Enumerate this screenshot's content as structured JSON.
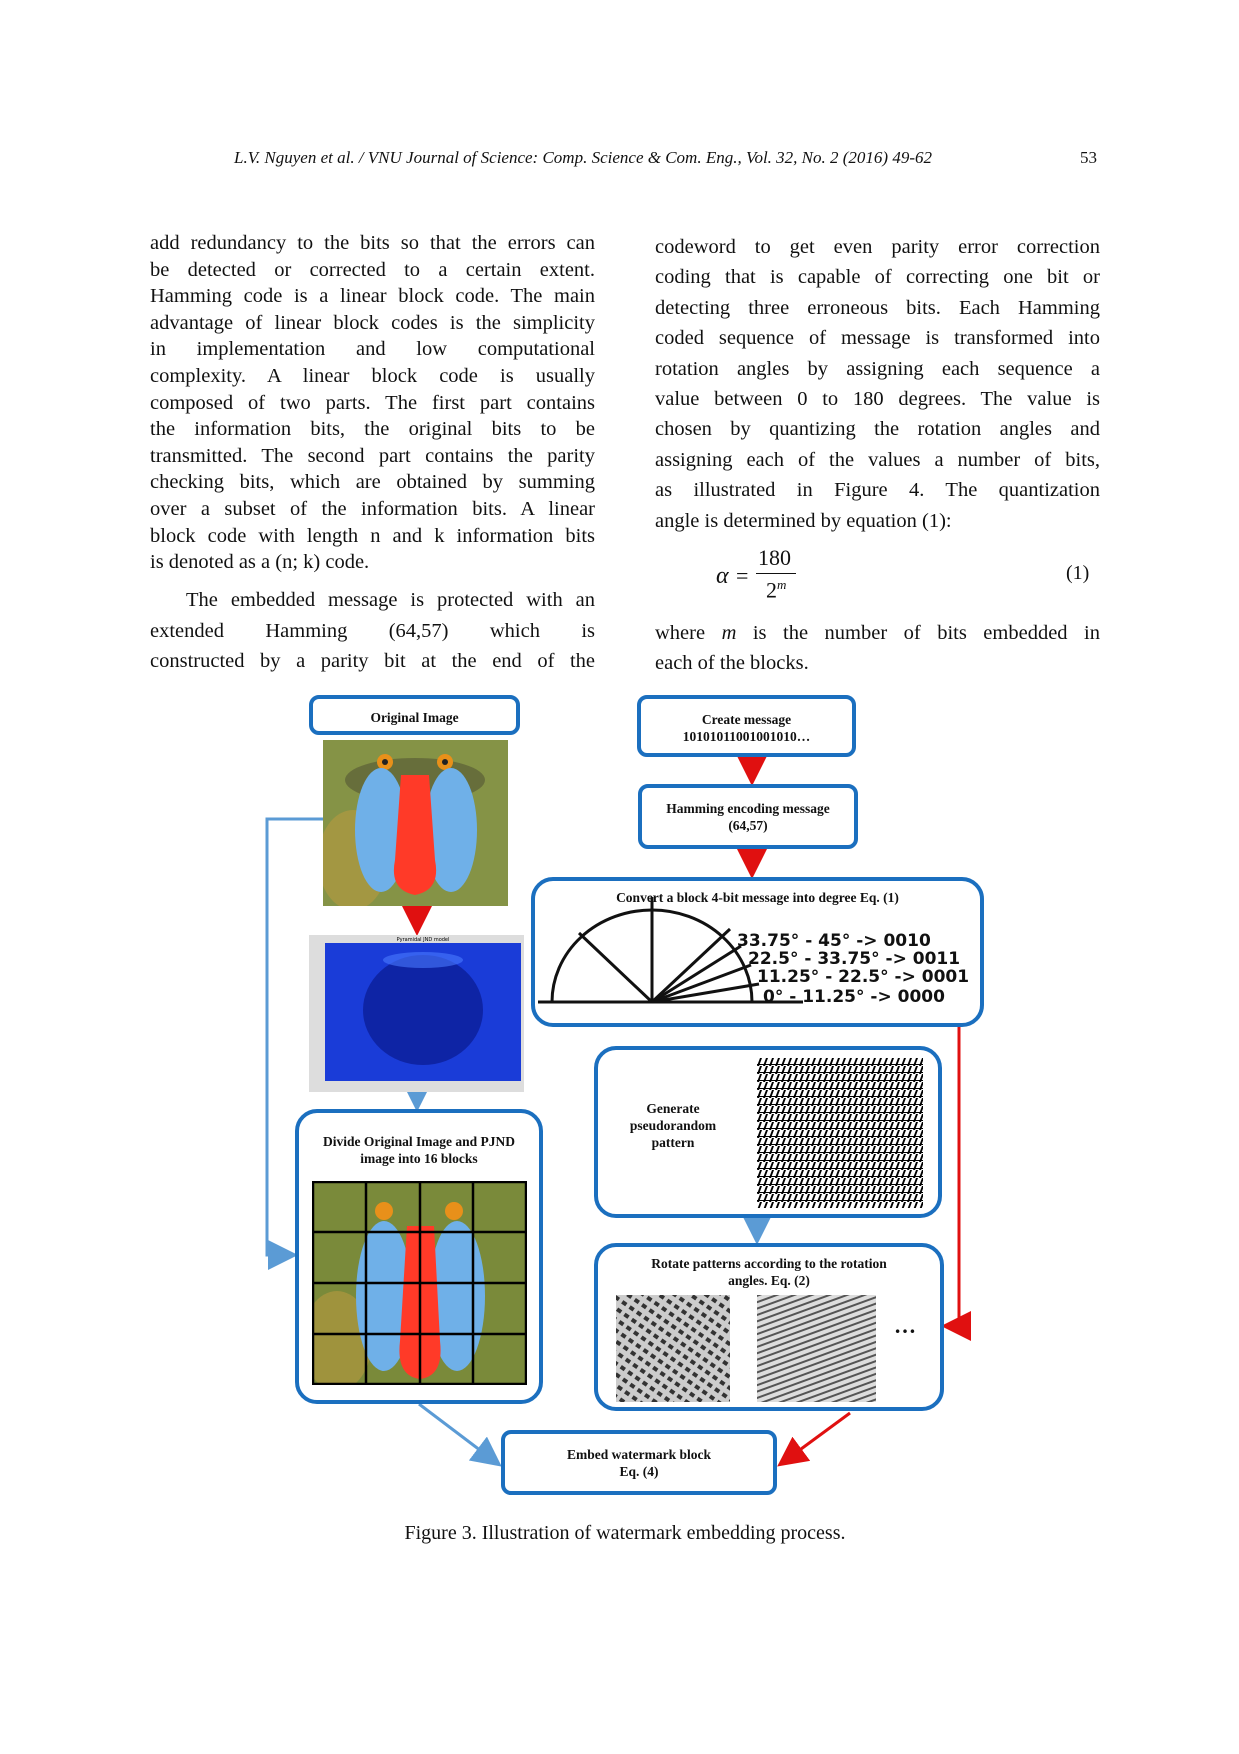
{
  "header": {
    "running_title": "L.V. Nguyen et al. / VNU Journal of Science: Comp. Science & Com. Eng., Vol. 32, No. 2 (2016) 49-62",
    "page_number": "53"
  },
  "left_column": {
    "paragraph1": [
      "add redundancy to the bits so that the errors can",
      "be detected or corrected to a certain extent.",
      "Hamming code is a linear block code. The main",
      "advantage of linear block codes is the simplicity",
      "in implementation and low computational",
      "complexity. A linear block code is usually",
      "composed of two parts. The first part contains",
      "the information bits, the original bits to be",
      "transmitted. The second part contains the parity",
      "checking bits, which are obtained by summing",
      "over a subset of the information bits. A linear",
      "block code with length n and k information bits",
      "is denoted as a (n; k) code."
    ],
    "paragraph2": [
      "The embedded message is protected with an",
      "extended Hamming (64,57) which is",
      "constructed by a parity bit at the end of the"
    ]
  },
  "right_column": {
    "paragraph1": [
      "codeword to get even parity error correction",
      "coding that is capable of correcting one bit or",
      "detecting three erroneous bits. Each Hamming",
      "coded sequence of message is transformed into",
      "rotation angles by assigning each sequence a",
      "value between 0 to 180 degrees. The value is",
      "chosen by quantizing the rotation angles and",
      "assigning each of the values a number of bits,",
      "as illustrated in Figure 4. The quantization",
      "angle is determined by equation (1):"
    ],
    "equation": {
      "lhs": "α",
      "equals": "=",
      "numerator": "180",
      "denominator_base": "2",
      "exponent": "m",
      "number": "(1)"
    },
    "paragraph2": {
      "line1_pre": "where ",
      "line1_var": "m",
      "line1_post": " is the number of bits embedded in",
      "line2": "each of the blocks."
    }
  },
  "figure": {
    "original_image": "Original Image",
    "pjnd_title": "Pyramidal JND model",
    "divide": [
      "Divide Original Image and PJND",
      "image into 16 blocks"
    ],
    "create_message": [
      "Create message",
      "10101011001001010…"
    ],
    "hamming": [
      "Hamming encoding message",
      "(64,57)"
    ],
    "convert": "Convert a block 4-bit message into degree Eq. (1)",
    "angle_labels": [
      "33.75° - 45° -> 0010",
      "22.5° - 33.75° -> 0011",
      "11.25° - 22.5° -> 0001",
      "0° - 11.25° -> 0000"
    ],
    "generate": [
      "Generate",
      "pseudorandom",
      "pattern"
    ],
    "rotate": [
      "Rotate patterns according to the rotation",
      "angles. Eq. (2)"
    ],
    "ellipsis": "…",
    "embed": [
      "Embed watermark block",
      "Eq. (4)"
    ],
    "caption": "Figure 3. Illustration of watermark embedding process.",
    "colors": {
      "box_border": "#1b6fbf",
      "blue_arrow": "#5b9bd5",
      "red_arrow": "#e01010"
    }
  }
}
